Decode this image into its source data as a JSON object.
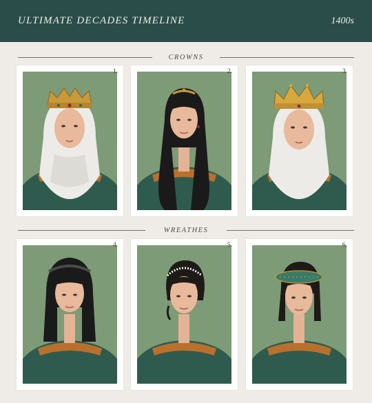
{
  "header": {
    "title": "ULTIMATE DECADES TIMELINE",
    "decade": "1400s"
  },
  "sections": [
    {
      "label": "CROWNS"
    },
    {
      "label": "WREATHES"
    }
  ],
  "cards": [
    {
      "number": "1.",
      "subject": "woman-white-wimple-gold-crown"
    },
    {
      "number": "2.",
      "subject": "woman-long-black-hair-gold-circlet"
    },
    {
      "number": "3.",
      "subject": "woman-white-wimple-gold-open-crown"
    },
    {
      "number": "4.",
      "subject": "woman-black-hair-headband"
    },
    {
      "number": "5.",
      "subject": "woman-updo-pearl-wreath"
    },
    {
      "number": "6.",
      "subject": "woman-braided-updo-green-roll-wreath"
    }
  ],
  "colors": {
    "header_bg": "#2a4d4a",
    "page_bg": "#efece7",
    "photo_bg": "#7d9b76",
    "gown": "#2f5b4f",
    "neckline_trim": "#b9702c"
  }
}
